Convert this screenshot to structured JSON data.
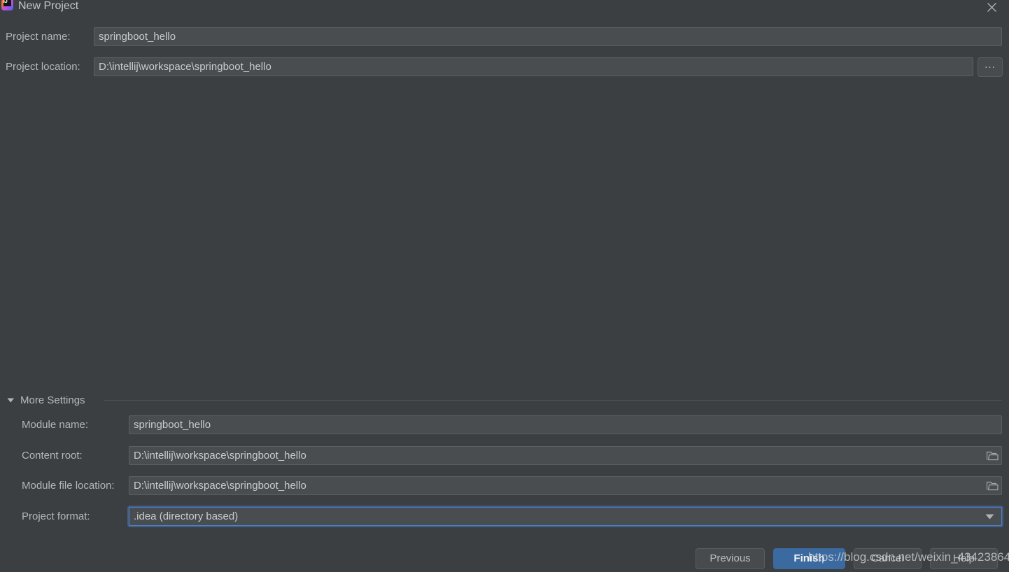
{
  "window": {
    "title": "New Project",
    "app_icon": "intellij-idea-icon",
    "icon_text": "IJ",
    "close_icon": "close-icon"
  },
  "colors": {
    "background": "#3b3f42",
    "field_background": "#4a4d4f",
    "field_border": "#5c5f61",
    "text": "#b9bcbd",
    "accent_focus": "#4e7ec4",
    "primary_button": "#3b6aa0"
  },
  "main": {
    "project_name": {
      "label": "Project name:",
      "value": "springboot_hello"
    },
    "project_location": {
      "label": "Project location:",
      "value": "D:\\intellij\\workspace\\springboot_hello",
      "browse_label": "..."
    }
  },
  "more_settings": {
    "label": "More Settings",
    "expanded": true,
    "toggle_icon": "chevron-down-icon",
    "fields": [
      {
        "name": "module-name",
        "label": "Module name:",
        "value": "springboot_hello",
        "type": "text",
        "trailing_icon": null
      },
      {
        "name": "content-root",
        "label": "Content root:",
        "value": "D:\\intellij\\workspace\\springboot_hello",
        "type": "text",
        "trailing_icon": "folder-icon"
      },
      {
        "name": "module-file-location",
        "label": "Module file location:",
        "value": "D:\\intellij\\workspace\\springboot_hello",
        "type": "text",
        "trailing_icon": "folder-icon"
      },
      {
        "name": "project-format",
        "label": "Project format:",
        "value": ".idea (directory based)",
        "type": "combobox",
        "trailing_icon": "chevron-down-icon",
        "focused": true
      }
    ]
  },
  "footer": {
    "previous_label": "Previous",
    "finish_label": "Finish",
    "cancel_label": "Cancel",
    "help_label": "Help"
  },
  "watermark": {
    "text": "https://blog.csdn.net/weixin_43423864"
  }
}
